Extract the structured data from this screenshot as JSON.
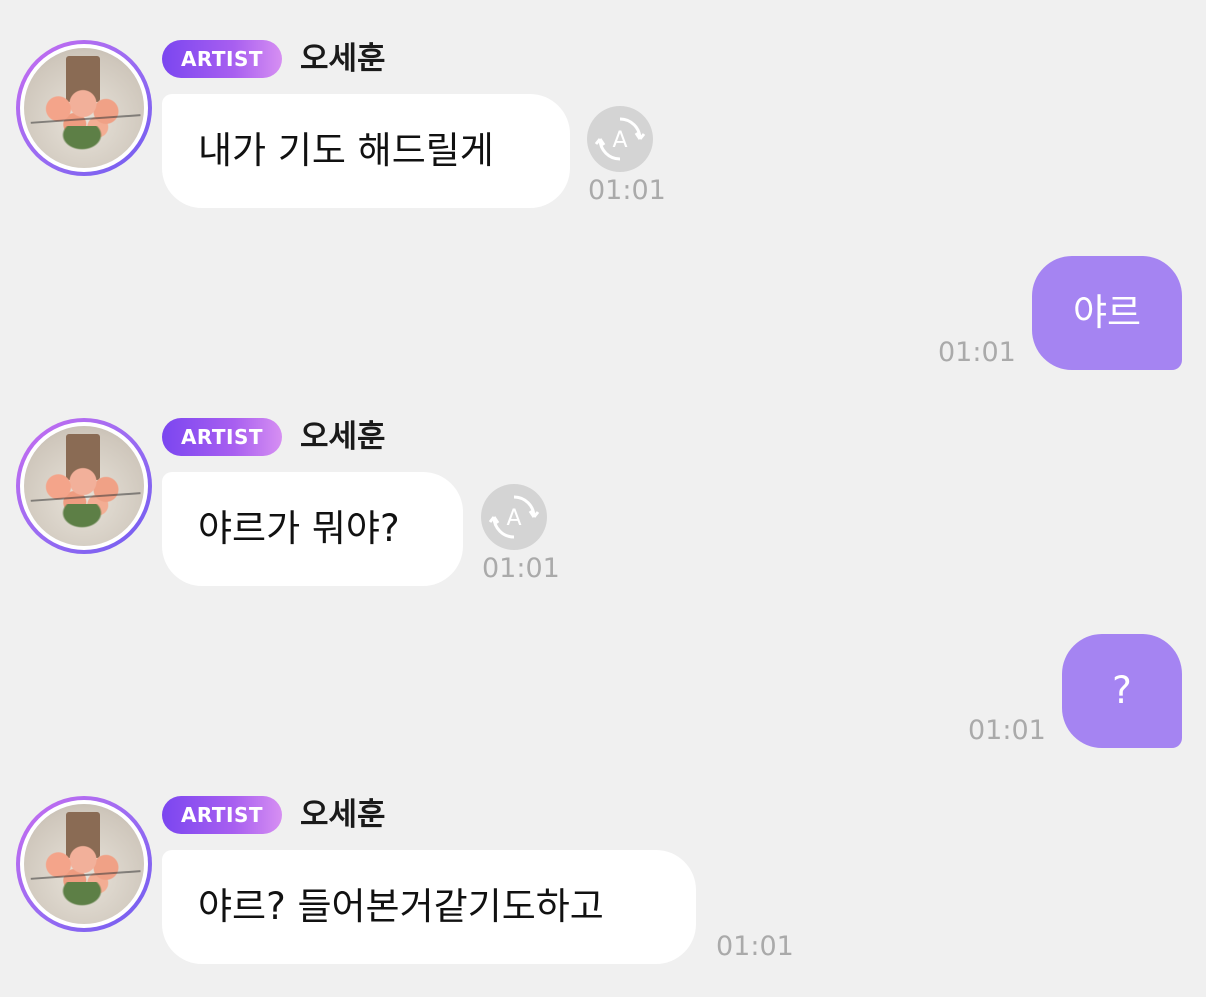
{
  "messages": [
    {
      "direction": "incoming",
      "badge": "ARTIST",
      "sender": "오세훈",
      "text": "내가 기도 해드릴게",
      "time": "01:01",
      "has_translate": true
    },
    {
      "direction": "outgoing",
      "text": "야르",
      "time": "01:01"
    },
    {
      "direction": "incoming",
      "badge": "ARTIST",
      "sender": "오세훈",
      "text": "야르가 뭐야?",
      "time": "01:01",
      "has_translate": true
    },
    {
      "direction": "outgoing",
      "text": "?",
      "time": "01:01"
    },
    {
      "direction": "incoming",
      "badge": "ARTIST",
      "sender": "오세훈",
      "text": "야르? 들어본거같기도하고",
      "time": "01:01",
      "has_translate": false
    }
  ],
  "translate_icon_glyph": "A",
  "colors": {
    "background": "#f0f0f0",
    "incoming_bubble": "#ffffff",
    "outgoing_bubble": "#a584f2",
    "badge_gradient_start": "#7b46f0",
    "badge_gradient_end": "#d68ff2",
    "timestamp": "#aaaaaa",
    "translate_button": "#d4d4d4"
  },
  "icons": {
    "avatar": "artist-avatar-bouquet-photo",
    "translate": "translate-icon"
  }
}
